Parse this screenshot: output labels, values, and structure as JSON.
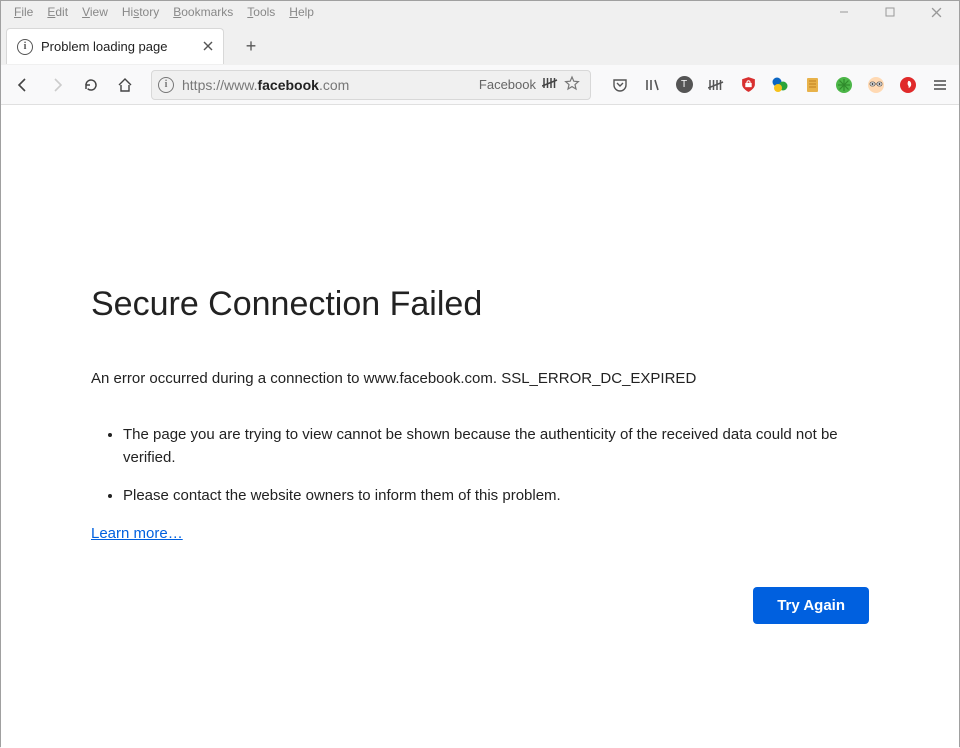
{
  "menubar": {
    "items": [
      "File",
      "Edit",
      "View",
      "History",
      "Bookmarks",
      "Tools",
      "Help"
    ]
  },
  "tab": {
    "title": "Problem loading page"
  },
  "url": {
    "scheme": "https://www.",
    "host": "facebook",
    "suffix": ".com",
    "badge_word": "Facebook"
  },
  "error": {
    "title": "Secure Connection Failed",
    "description": "An error occurred during a connection to www.facebook.com. SSL_ERROR_DC_EXPIRED",
    "bullets": [
      "The page you are trying to view cannot be shown because the authenticity of the received data could not be verified.",
      "Please contact the website owners to inform them of this problem."
    ],
    "learn_more": "Learn more…",
    "try_again": "Try Again"
  }
}
